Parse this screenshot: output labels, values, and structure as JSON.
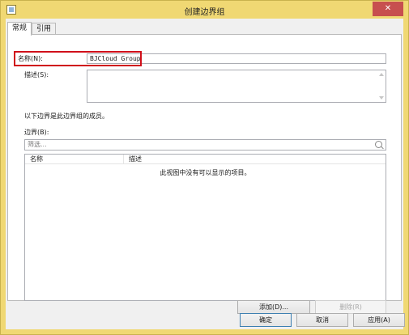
{
  "window": {
    "title": "创建边界组",
    "close_glyph": "✕"
  },
  "tabs": [
    {
      "label": "常规"
    },
    {
      "label": "引用"
    }
  ],
  "general": {
    "name_label": "名称(N):",
    "name_value": "BJCloud Group",
    "description_label": "描述(S):",
    "description_value": "",
    "members_caption": "以下边界是此边界组的成员。",
    "boundaries_label": "边界(B):",
    "filter_placeholder": "筛选...",
    "columns": [
      "名称",
      "描述"
    ],
    "empty_message": "此视图中没有可以显示的项目。",
    "add_label": "添加(D)...",
    "remove_label": "删除(R)"
  },
  "footer": {
    "ok_label": "确定",
    "cancel_label": "取消",
    "apply_label": "应用(A)"
  },
  "colors": {
    "title_bar": "#f0d873",
    "highlight": "#d0101a",
    "close_button": "#c74f4f"
  }
}
